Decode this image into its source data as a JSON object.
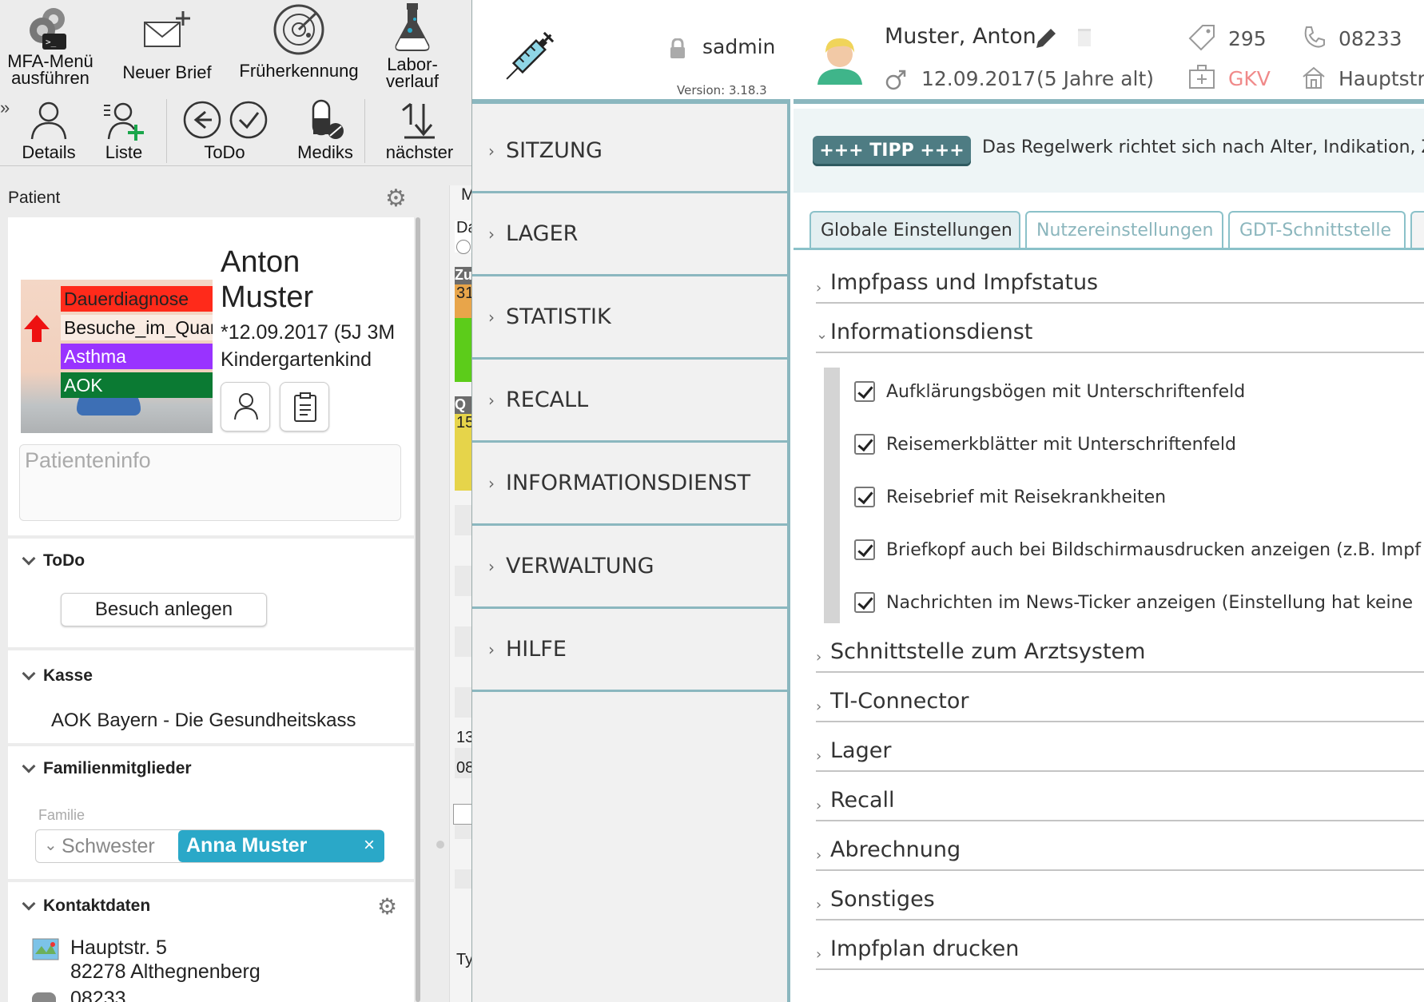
{
  "toolbar_top": [
    {
      "label": "MFA-Menü\nausführen",
      "icon": "terminal-gear-icon"
    },
    {
      "label": "Neuer Brief",
      "icon": "new-letter-icon"
    },
    {
      "label": "Früherkennung",
      "icon": "radar-icon"
    },
    {
      "label": "Labor-\nverlauf",
      "icon": "lab-flask-icon"
    }
  ],
  "toolbar_bottom": [
    {
      "label": "Details",
      "icon": "person-icon"
    },
    {
      "label": "Liste",
      "icon": "person-list-add-icon"
    },
    {
      "label": "ToDo",
      "icon": "back-check-icon"
    },
    {
      "label": "Mediks",
      "icon": "pill-icon"
    },
    {
      "label": "nächster",
      "icon": "next-sort-icon"
    }
  ],
  "patient_panel": {
    "title": "Patient",
    "first_name": "Anton",
    "last_name": "Muster",
    "birth": "*12.09.2017 (5J 3M",
    "status": "Kindergartenkind",
    "tags": [
      {
        "label": "Dauerdiagnose",
        "color": "#ff2a1a"
      },
      {
        "label": "Besuche_im_Quartal",
        "color": "#ffffff"
      },
      {
        "label": "Asthma",
        "color": "#9933ff"
      },
      {
        "label": "AOK",
        "color": "#0b7a33"
      }
    ],
    "info_placeholder": "Patienteninfo"
  },
  "todo": {
    "title": "ToDo",
    "button": "Besuch anlegen"
  },
  "kasse": {
    "title": "Kasse",
    "value": "AOK Bayern - Die Gesundheitskass"
  },
  "family": {
    "title": "Familienmitglieder",
    "label": "Familie",
    "relation": "Schwester",
    "member": "Anna Muster"
  },
  "contact": {
    "title": "Kontaktdaten",
    "street": "Hauptstr. 5",
    "city": "82278 Althegnenberg",
    "phone_partial": "08233"
  },
  "middle_strip": {
    "texts": [
      "M",
      "Da",
      "Zu",
      "31",
      "Q",
      "15",
      "13",
      "08",
      "Ty"
    ]
  },
  "impf_app": {
    "user": "sadmin",
    "version": "Version: 3.18.3",
    "nav": [
      "SITZUNG",
      "LAGER",
      "STATISTIK",
      "RECALL",
      "INFORMATIONSDIENST",
      "VERWALTUNG",
      "HILFE"
    ],
    "header": {
      "name": "Muster, Anton",
      "birth": "12.09.2017",
      "age": "(5 Jahre alt)",
      "id": "295",
      "insurance": "GKV",
      "phone": "08233",
      "address": "Hauptstr."
    },
    "tipp": {
      "badge": "+++ TIPP +++",
      "text": "Das Regelwerk richtet sich nach Alter, Indikation, Z"
    },
    "tabs": [
      "Globale Einstellungen",
      "Nutzereinstellungen",
      "GDT-Schnittstelle"
    ],
    "sections_top": [
      {
        "label": "Impfpass und Impfstatus",
        "expanded": false
      },
      {
        "label": "Informationsdienst",
        "expanded": true
      }
    ],
    "options": [
      "Aufklärungsbögen mit Unterschriftenfeld",
      "Reisemerkblätter mit Unterschriftenfeld",
      "Reisebrief mit Reisekrankheiten",
      "Briefkopf auch bei Bildschirmausdrucken anzeigen (z.B. Impf",
      "Nachrichten im News-Ticker anzeigen (Einstellung hat keine"
    ],
    "sections_bottom": [
      "Schnittstelle zum Arztsystem",
      "TI-Connector",
      "Lager",
      "Recall",
      "Abrechnung",
      "Sonstiges",
      "Impfplan drucken"
    ]
  },
  "colors": {
    "accent": "#8bb7bf",
    "tipp": "#4e7c83",
    "gkv": "#f08a8a",
    "family_chip": "#2aa8c8"
  }
}
